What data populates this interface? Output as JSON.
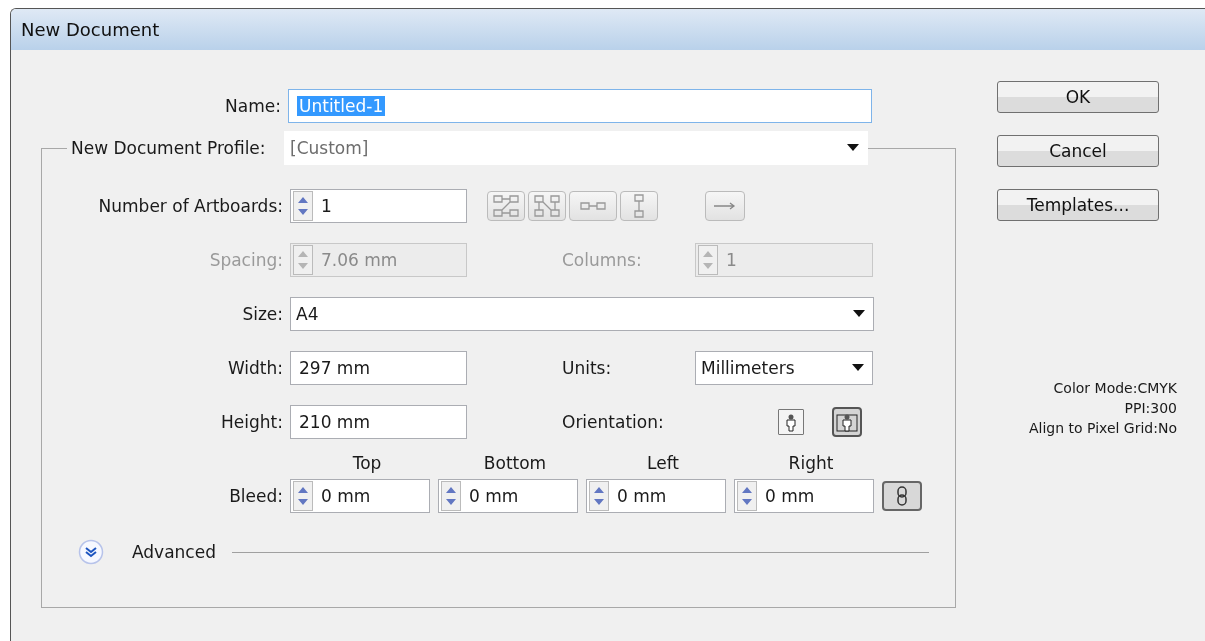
{
  "window": {
    "title": "New Document"
  },
  "name": {
    "label": "Name:",
    "value": "Untitled-1",
    "selected": true
  },
  "profile": {
    "label": "New Document Profile:",
    "value": "[Custom]"
  },
  "artboards": {
    "label": "Number of Artboards:",
    "value": "1",
    "disabled": false
  },
  "spacing": {
    "label": "Spacing:",
    "value": "7.06 mm",
    "disabled": true
  },
  "columns": {
    "label": "Columns:",
    "value": "1",
    "disabled": true
  },
  "size": {
    "label": "Size:",
    "value": "A4"
  },
  "width": {
    "label": "Width:",
    "value": "297 mm"
  },
  "units": {
    "label": "Units:",
    "value": "Millimeters"
  },
  "height": {
    "label": "Height:",
    "value": "210 mm"
  },
  "orientation": {
    "label": "Orientation:",
    "options": [
      {
        "kind": "portrait",
        "selected": false
      },
      {
        "kind": "landscape",
        "selected": true
      }
    ]
  },
  "bleed": {
    "label": "Bleed:",
    "fields": [
      {
        "heading": "Top",
        "value": "0 mm"
      },
      {
        "heading": "Bottom",
        "value": "0 mm"
      },
      {
        "heading": "Left",
        "value": "0 mm"
      },
      {
        "heading": "Right",
        "value": "0 mm"
      }
    ]
  },
  "advanced": {
    "label": "Advanced",
    "expanded": false
  },
  "buttons": [
    "OK",
    "Cancel",
    "Templates..."
  ],
  "info": [
    "Color Mode:CMYK",
    "PPI:300",
    "Align to Pixel Grid:No"
  ]
}
